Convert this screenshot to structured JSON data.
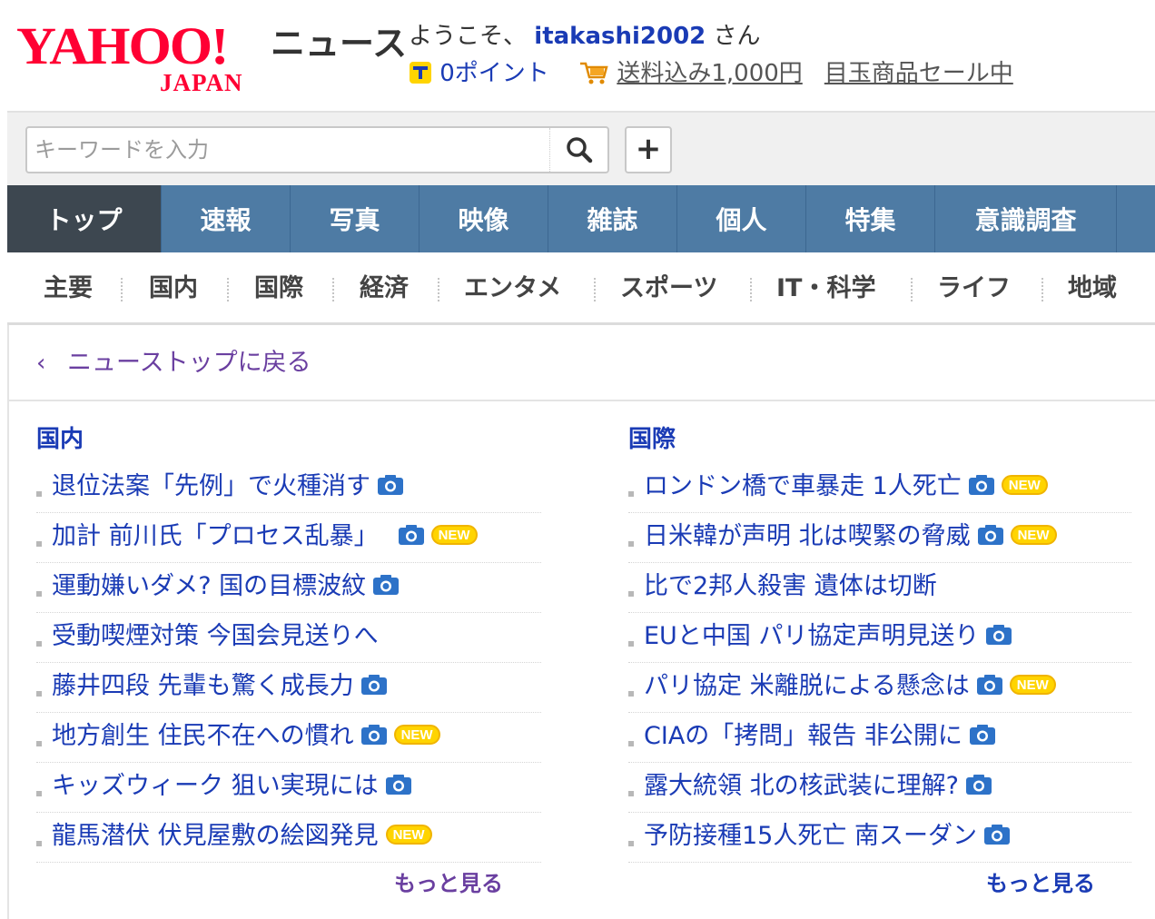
{
  "header": {
    "logo_text": "YAHOO!",
    "logo_sub": "JAPAN",
    "service_name": "ニュース",
    "welcome_prefix": "ようこそ、",
    "username": "itakashi2002",
    "welcome_suffix": "さん",
    "points_text": "0ポイント",
    "promo_text": "送料込み1,000円",
    "promo2_text": "目玉商品セール中"
  },
  "search": {
    "placeholder": "キーワードを入力",
    "add_label": "+"
  },
  "main_tabs": [
    {
      "label": "トップ"
    },
    {
      "label": "速報"
    },
    {
      "label": "写真"
    },
    {
      "label": "映像"
    },
    {
      "label": "雑誌"
    },
    {
      "label": "個人"
    },
    {
      "label": "特集"
    },
    {
      "label": "意識調査"
    }
  ],
  "categories": [
    {
      "label": "主要"
    },
    {
      "label": "国内"
    },
    {
      "label": "国際"
    },
    {
      "label": "経済"
    },
    {
      "label": "エンタメ"
    },
    {
      "label": "スポーツ"
    },
    {
      "label": "IT・科学"
    },
    {
      "label": "ライフ"
    },
    {
      "label": "地域"
    }
  ],
  "back_link": "ニューストップに戻る",
  "badge_new": "NEW",
  "columns": [
    {
      "title": "国内",
      "more": "もっと見る",
      "items": [
        {
          "text": "退位法案「先例」で火種消す",
          "photo": true,
          "new": false
        },
        {
          "text": "加計 前川氏「プロセス乱暴」",
          "photo": true,
          "new": true
        },
        {
          "text": "運動嫌いダメ? 国の目標波紋",
          "photo": true,
          "new": false
        },
        {
          "text": "受動喫煙対策 今国会見送りへ",
          "photo": false,
          "new": false
        },
        {
          "text": "藤井四段 先輩も驚く成長力",
          "photo": true,
          "new": false
        },
        {
          "text": "地方創生 住民不在への慣れ",
          "photo": true,
          "new": true
        },
        {
          "text": "キッズウィーク 狙い実現には",
          "photo": true,
          "new": false
        },
        {
          "text": "龍馬潜伏 伏見屋敷の絵図発見",
          "photo": false,
          "new": true
        }
      ]
    },
    {
      "title": "国際",
      "more": "もっと見る",
      "items": [
        {
          "text": "ロンドン橋で車暴走 1人死亡",
          "photo": true,
          "new": true
        },
        {
          "text": "日米韓が声明 北は喫緊の脅威",
          "photo": true,
          "new": true
        },
        {
          "text": "比で2邦人殺害 遺体は切断",
          "photo": false,
          "new": false
        },
        {
          "text": "EUと中国 パリ協定声明見送り",
          "photo": true,
          "new": false
        },
        {
          "text": "パリ協定 米離脱による懸念は",
          "photo": true,
          "new": true
        },
        {
          "text": "CIAの「拷問」報告 非公開に",
          "photo": true,
          "new": false
        },
        {
          "text": "露大統領 北の核武装に理解?",
          "photo": true,
          "new": false
        },
        {
          "text": "予防接種15人死亡 南スーダン",
          "photo": true,
          "new": false
        }
      ]
    }
  ]
}
